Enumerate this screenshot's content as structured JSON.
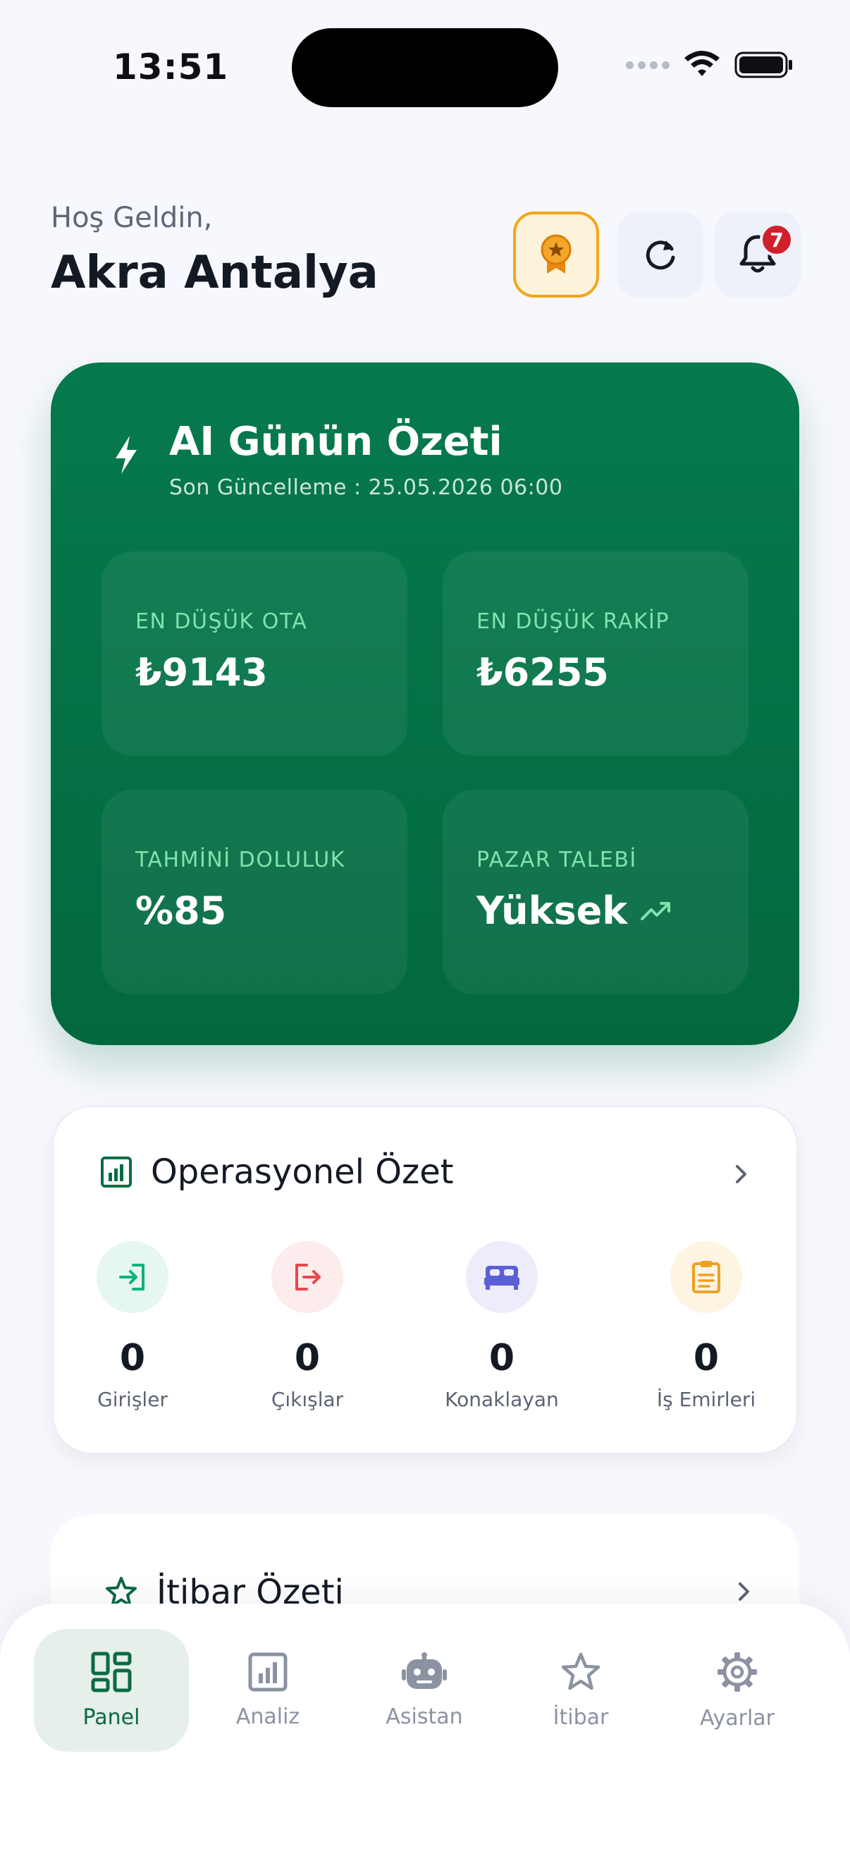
{
  "status_bar": {
    "time": "13:51"
  },
  "header": {
    "greeting": "Hoş Geldin,",
    "user_name": "Akra Antalya",
    "notification_count": "7"
  },
  "ai_summary": {
    "title": "AI Günün Özeti",
    "last_update": "Son Güncelleme : 25.05.2026 06:00",
    "stats": [
      {
        "label": "EN DÜŞÜK OTA",
        "value": "₺9143"
      },
      {
        "label": "EN DÜŞÜK RAKİP",
        "value": "₺6255"
      },
      {
        "label": "TAHMİNİ DOLULUK",
        "value": "%85"
      },
      {
        "label": "PAZAR TALEBİ",
        "value": "Yüksek"
      }
    ]
  },
  "operational": {
    "title": "Operasyonel Özet",
    "items": [
      {
        "count": "0",
        "label": "Girişler",
        "icon": "login-icon",
        "color": "#10b27a",
        "bg": "#e6f7f0"
      },
      {
        "count": "0",
        "label": "Çıkışlar",
        "icon": "logout-icon",
        "color": "#e5484d",
        "bg": "#fdecec"
      },
      {
        "count": "0",
        "label": "Konaklayan",
        "icon": "bed-icon",
        "color": "#5b5fd6",
        "bg": "#ececfb"
      },
      {
        "count": "0",
        "label": "İş Emirleri",
        "icon": "clipboard-icon",
        "color": "#f0a020",
        "bg": "#fef4e2"
      }
    ]
  },
  "reputation": {
    "title": "İtibar Özeti"
  },
  "nav": {
    "items": [
      {
        "label": "Panel",
        "icon": "dashboard-icon",
        "active": true
      },
      {
        "label": "Analiz",
        "icon": "chart-icon",
        "active": false
      },
      {
        "label": "Asistan",
        "icon": "robot-icon",
        "active": false
      },
      {
        "label": "İtibar",
        "icon": "star-icon",
        "active": false
      },
      {
        "label": "Ayarlar",
        "icon": "gear-icon",
        "active": false
      }
    ]
  },
  "colors": {
    "brand_green": "#067a4d",
    "accent_gold": "#f2a51c",
    "badge_red": "#d1202a"
  }
}
